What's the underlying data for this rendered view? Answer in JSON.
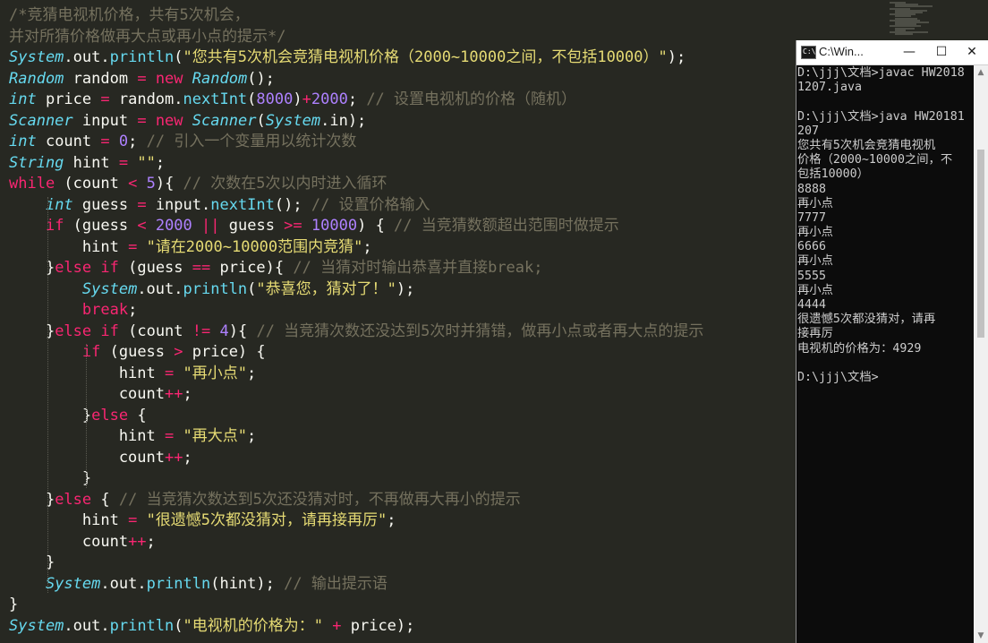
{
  "editor": {
    "lines": [
      [
        {
          "t": "/*竞猜电视机价格，共有5次机会，",
          "c": "cm"
        }
      ],
      [
        {
          "t": "并对所猜价格做再大点或再小点的提示*/",
          "c": "cm"
        }
      ],
      [
        {
          "t": "System",
          "c": "type"
        },
        {
          "t": ".out.",
          "c": "plain"
        },
        {
          "t": "println",
          "c": "func"
        },
        {
          "t": "(",
          "c": "plain"
        },
        {
          "t": "\"您共有5次机会竞猜电视机价格（2000~10000之间，不包括10000）\"",
          "c": "str"
        },
        {
          "t": ");",
          "c": "plain"
        }
      ],
      [
        {
          "t": "Random",
          "c": "type"
        },
        {
          "t": " random ",
          "c": "plain"
        },
        {
          "t": "=",
          "c": "op"
        },
        {
          "t": " ",
          "c": "plain"
        },
        {
          "t": "new",
          "c": "kw"
        },
        {
          "t": " ",
          "c": "plain"
        },
        {
          "t": "Random",
          "c": "type"
        },
        {
          "t": "();",
          "c": "plain"
        }
      ],
      [
        {
          "t": "int",
          "c": "type"
        },
        {
          "t": " price ",
          "c": "plain"
        },
        {
          "t": "=",
          "c": "op"
        },
        {
          "t": " random.",
          "c": "plain"
        },
        {
          "t": "nextInt",
          "c": "func"
        },
        {
          "t": "(",
          "c": "plain"
        },
        {
          "t": "8000",
          "c": "num"
        },
        {
          "t": ")",
          "c": "plain"
        },
        {
          "t": "+",
          "c": "op"
        },
        {
          "t": "2000",
          "c": "num"
        },
        {
          "t": "; ",
          "c": "plain"
        },
        {
          "t": "// 设置电视机的价格（随机）",
          "c": "cm"
        }
      ],
      [
        {
          "t": "Scanner",
          "c": "type"
        },
        {
          "t": " input ",
          "c": "plain"
        },
        {
          "t": "=",
          "c": "op"
        },
        {
          "t": " ",
          "c": "plain"
        },
        {
          "t": "new",
          "c": "kw"
        },
        {
          "t": " ",
          "c": "plain"
        },
        {
          "t": "Scanner",
          "c": "type"
        },
        {
          "t": "(",
          "c": "plain"
        },
        {
          "t": "System",
          "c": "type"
        },
        {
          "t": ".in);",
          "c": "plain"
        }
      ],
      [
        {
          "t": "int",
          "c": "type"
        },
        {
          "t": " count ",
          "c": "plain"
        },
        {
          "t": "=",
          "c": "op"
        },
        {
          "t": " ",
          "c": "plain"
        },
        {
          "t": "0",
          "c": "num"
        },
        {
          "t": "; ",
          "c": "plain"
        },
        {
          "t": "// 引入一个变量用以统计次数",
          "c": "cm"
        }
      ],
      [
        {
          "t": "String",
          "c": "type"
        },
        {
          "t": " hint ",
          "c": "plain"
        },
        {
          "t": "=",
          "c": "op"
        },
        {
          "t": " ",
          "c": "plain"
        },
        {
          "t": "\"\"",
          "c": "str"
        },
        {
          "t": ";",
          "c": "plain"
        }
      ],
      [
        {
          "t": "while",
          "c": "kw"
        },
        {
          "t": " (count ",
          "c": "plain"
        },
        {
          "t": "<",
          "c": "op"
        },
        {
          "t": " ",
          "c": "plain"
        },
        {
          "t": "5",
          "c": "num"
        },
        {
          "t": "){ ",
          "c": "plain"
        },
        {
          "t": "// 次数在5次以内时进入循环",
          "c": "cm"
        }
      ],
      [
        {
          "t": "    ",
          "c": "plain"
        },
        {
          "t": "int",
          "c": "type"
        },
        {
          "t": " guess ",
          "c": "plain"
        },
        {
          "t": "=",
          "c": "op"
        },
        {
          "t": " input.",
          "c": "plain"
        },
        {
          "t": "nextInt",
          "c": "func"
        },
        {
          "t": "(); ",
          "c": "plain"
        },
        {
          "t": "// 设置价格输入",
          "c": "cm"
        }
      ],
      [
        {
          "t": "    ",
          "c": "plain"
        },
        {
          "t": "if",
          "c": "kw"
        },
        {
          "t": " (guess ",
          "c": "plain"
        },
        {
          "t": "<",
          "c": "op"
        },
        {
          "t": " ",
          "c": "plain"
        },
        {
          "t": "2000",
          "c": "num"
        },
        {
          "t": " ",
          "c": "plain"
        },
        {
          "t": "||",
          "c": "op"
        },
        {
          "t": " guess ",
          "c": "plain"
        },
        {
          "t": ">=",
          "c": "op"
        },
        {
          "t": " ",
          "c": "plain"
        },
        {
          "t": "10000",
          "c": "num"
        },
        {
          "t": ") { ",
          "c": "plain"
        },
        {
          "t": "// 当竞猜数额超出范围时做提示",
          "c": "cm"
        }
      ],
      [
        {
          "t": "        hint ",
          "c": "plain"
        },
        {
          "t": "=",
          "c": "op"
        },
        {
          "t": " ",
          "c": "plain"
        },
        {
          "t": "\"请在2000~10000范围内竞猜\"",
          "c": "str"
        },
        {
          "t": ";",
          "c": "plain"
        }
      ],
      [
        {
          "t": "    }",
          "c": "plain"
        },
        {
          "t": "else",
          "c": "kw"
        },
        {
          "t": " ",
          "c": "plain"
        },
        {
          "t": "if",
          "c": "kw"
        },
        {
          "t": " (guess ",
          "c": "plain"
        },
        {
          "t": "==",
          "c": "op"
        },
        {
          "t": " price){ ",
          "c": "plain"
        },
        {
          "t": "// 当猜对时输出恭喜并直接break;",
          "c": "cm"
        }
      ],
      [
        {
          "t": "        ",
          "c": "plain"
        },
        {
          "t": "System",
          "c": "type"
        },
        {
          "t": ".out.",
          "c": "plain"
        },
        {
          "t": "println",
          "c": "func"
        },
        {
          "t": "(",
          "c": "plain"
        },
        {
          "t": "\"恭喜您，猜对了！\"",
          "c": "str"
        },
        {
          "t": ");",
          "c": "plain"
        }
      ],
      [
        {
          "t": "        ",
          "c": "plain"
        },
        {
          "t": "break",
          "c": "kw"
        },
        {
          "t": ";",
          "c": "plain"
        }
      ],
      [
        {
          "t": "    }",
          "c": "plain"
        },
        {
          "t": "else",
          "c": "kw"
        },
        {
          "t": " ",
          "c": "plain"
        },
        {
          "t": "if",
          "c": "kw"
        },
        {
          "t": " (count ",
          "c": "plain"
        },
        {
          "t": "!=",
          "c": "op"
        },
        {
          "t": " ",
          "c": "plain"
        },
        {
          "t": "4",
          "c": "num"
        },
        {
          "t": "){ ",
          "c": "plain"
        },
        {
          "t": "// 当竞猜次数还没达到5次时并猜错，做再小点或者再大点的提示",
          "c": "cm"
        }
      ],
      [
        {
          "t": "        ",
          "c": "plain"
        },
        {
          "t": "if",
          "c": "kw"
        },
        {
          "t": " (guess ",
          "c": "plain"
        },
        {
          "t": ">",
          "c": "op"
        },
        {
          "t": " price) {",
          "c": "plain"
        }
      ],
      [
        {
          "t": "            hint ",
          "c": "plain"
        },
        {
          "t": "=",
          "c": "op"
        },
        {
          "t": " ",
          "c": "plain"
        },
        {
          "t": "\"再小点\"",
          "c": "str"
        },
        {
          "t": ";",
          "c": "plain"
        }
      ],
      [
        {
          "t": "            count",
          "c": "plain"
        },
        {
          "t": "++",
          "c": "op"
        },
        {
          "t": ";",
          "c": "plain"
        }
      ],
      [
        {
          "t": "        }",
          "c": "plain"
        },
        {
          "t": "else",
          "c": "kw"
        },
        {
          "t": " {",
          "c": "plain"
        }
      ],
      [
        {
          "t": "            hint ",
          "c": "plain"
        },
        {
          "t": "=",
          "c": "op"
        },
        {
          "t": " ",
          "c": "plain"
        },
        {
          "t": "\"再大点\"",
          "c": "str"
        },
        {
          "t": ";",
          "c": "plain"
        }
      ],
      [
        {
          "t": "            count",
          "c": "plain"
        },
        {
          "t": "++",
          "c": "op"
        },
        {
          "t": ";",
          "c": "plain"
        }
      ],
      [
        {
          "t": "        }",
          "c": "plain"
        }
      ],
      [
        {
          "t": "    }",
          "c": "plain"
        },
        {
          "t": "else",
          "c": "kw"
        },
        {
          "t": " { ",
          "c": "plain"
        },
        {
          "t": "// 当竞猜次数达到5次还没猜对时，不再做再大再小的提示",
          "c": "cm"
        }
      ],
      [
        {
          "t": "        hint ",
          "c": "plain"
        },
        {
          "t": "=",
          "c": "op"
        },
        {
          "t": " ",
          "c": "plain"
        },
        {
          "t": "\"很遗憾5次都没猜对，请再接再厉\"",
          "c": "str"
        },
        {
          "t": ";",
          "c": "plain"
        }
      ],
      [
        {
          "t": "        count",
          "c": "plain"
        },
        {
          "t": "++",
          "c": "op"
        },
        {
          "t": ";",
          "c": "plain"
        }
      ],
      [
        {
          "t": "    }",
          "c": "plain"
        }
      ],
      [
        {
          "t": "    ",
          "c": "plain"
        },
        {
          "t": "System",
          "c": "type"
        },
        {
          "t": ".out.",
          "c": "plain"
        },
        {
          "t": "println",
          "c": "func"
        },
        {
          "t": "(hint); ",
          "c": "plain"
        },
        {
          "t": "// 输出提示语",
          "c": "cm"
        }
      ],
      [
        {
          "t": "}",
          "c": "plain"
        }
      ],
      [
        {
          "t": "System",
          "c": "type"
        },
        {
          "t": ".out.",
          "c": "plain"
        },
        {
          "t": "println",
          "c": "func"
        },
        {
          "t": "(",
          "c": "plain"
        },
        {
          "t": "\"电视机的价格为：\"",
          "c": "str"
        },
        {
          "t": " ",
          "c": "plain"
        },
        {
          "t": "+",
          "c": "op"
        },
        {
          "t": " price);",
          "c": "plain"
        }
      ]
    ],
    "colors": {
      "background": "#272822",
      "keyword": "#f92672",
      "type": "#66d9ef",
      "string": "#e6db74",
      "number": "#ae81ff",
      "comment": "#75715e",
      "text": "#f8f8f2"
    }
  },
  "terminal": {
    "title": "C:\\Win...",
    "icon": "console-icon",
    "controls": {
      "minimize": "—",
      "maximize": "☐",
      "close": "✕"
    },
    "output_lines": [
      "D:\\jjj\\文档>javac HW2018",
      "1207.java",
      "",
      "D:\\jjj\\文档>java HW20181",
      "207",
      "您共有5次机会竞猜电视机",
      "价格（2000~10000之间，不",
      "包括10000）",
      "8888",
      "再小点",
      "7777",
      "再小点",
      "6666",
      "再小点",
      "5555",
      "再小点",
      "4444",
      "很遗憾5次都没猜对，请再",
      "接再厉",
      "电视机的价格为：4929",
      "",
      "D:\\jjj\\文档>"
    ],
    "colors": {
      "background": "#0c0c0c",
      "text": "#cccccc",
      "titlebar": "#ffffff"
    }
  }
}
